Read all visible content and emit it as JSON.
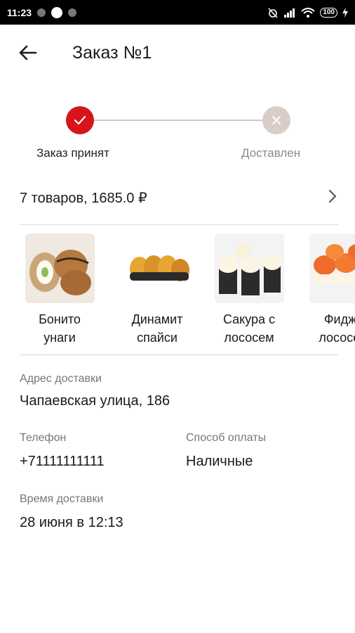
{
  "status_bar": {
    "time": "11:23",
    "battery": "100"
  },
  "header": {
    "title": "Заказ №1"
  },
  "order_status": {
    "steps": [
      {
        "label": "Заказ принят",
        "done": true,
        "color": "#d7141c"
      },
      {
        "label": "Доставлен",
        "done": false,
        "color": "#d9cdc8"
      }
    ]
  },
  "summary": {
    "text": "7 товаров, 1685.0 ₽"
  },
  "products": [
    {
      "name": "Бонито\nунаги",
      "icon": "sushi-roll-photo"
    },
    {
      "name": "Динамит\nспайси",
      "icon": "sushi-roll-photo"
    },
    {
      "name": "Сакура с\nлососем",
      "icon": "sushi-roll-photo"
    },
    {
      "name": "Фиджи\nлососем",
      "icon": "sushi-roll-photo"
    }
  ],
  "details": {
    "address_label": "Адрес доставки",
    "address_value": "Чапаевская улица, 186",
    "phone_label": "Телефон",
    "phone_value": "+71111111111",
    "payment_label": "Способ оплаты",
    "payment_value": "Наличные",
    "time_label": "Время доставки",
    "time_value": "28 июня в 12:13"
  },
  "colors": {
    "accent": "#d7141c",
    "inactive": "#d9cdc8"
  }
}
